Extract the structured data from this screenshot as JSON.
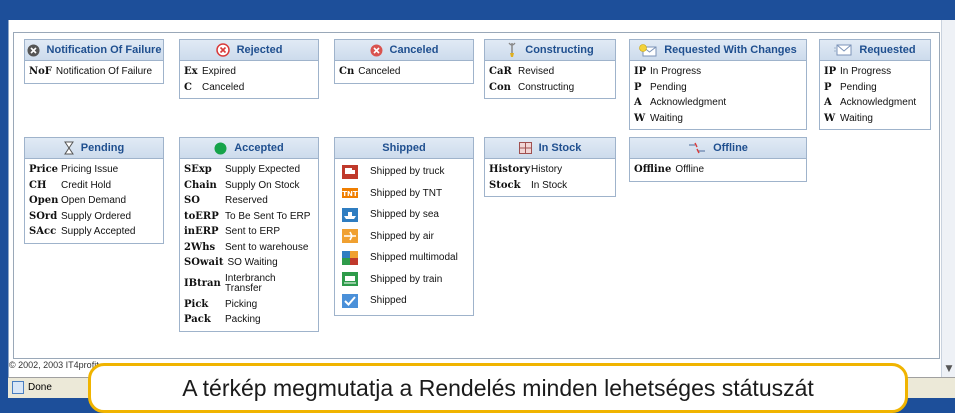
{
  "cards": {
    "nof": {
      "title": "Notification Of Failure",
      "rows": [
        {
          "code": "NoF",
          "label": "Notification Of Failure"
        }
      ]
    },
    "rejected": {
      "title": "Rejected",
      "rows": [
        {
          "code": "Ex",
          "label": "Expired"
        },
        {
          "code": "C",
          "label": "Canceled"
        }
      ]
    },
    "canceled": {
      "title": "Canceled",
      "rows": [
        {
          "code": "Cn",
          "label": "Canceled"
        }
      ]
    },
    "constructing": {
      "title": "Constructing",
      "rows": [
        {
          "code": "CaR",
          "label": "Revised"
        },
        {
          "code": "Con",
          "label": "Constructing"
        }
      ]
    },
    "req_changes": {
      "title": "Requested With Changes",
      "rows": [
        {
          "code": "IP",
          "label": "In Progress"
        },
        {
          "code": "P",
          "label": "Pending"
        },
        {
          "code": "A",
          "label": "Acknowledgment"
        },
        {
          "code": "W",
          "label": "Waiting"
        }
      ]
    },
    "requested": {
      "title": "Requested",
      "rows": [
        {
          "code": "IP",
          "label": "In Progress"
        },
        {
          "code": "P",
          "label": "Pending"
        },
        {
          "code": "A",
          "label": "Acknowledgment"
        },
        {
          "code": "W",
          "label": "Waiting"
        }
      ]
    },
    "pending": {
      "title": "Pending",
      "rows": [
        {
          "code": "Price",
          "label": "Pricing Issue"
        },
        {
          "code": "CH",
          "label": "Credit Hold"
        },
        {
          "code": "Open",
          "label": "Open Demand"
        },
        {
          "code": "SOrd",
          "label": "Supply Ordered"
        },
        {
          "code": "SAcc",
          "label": "Supply Accepted"
        }
      ]
    },
    "accepted": {
      "title": "Accepted",
      "rows": [
        {
          "code": "SExp",
          "label": "Supply Expected"
        },
        {
          "code": "Chain",
          "label": "Supply On Stock"
        },
        {
          "code": "SO",
          "label": "Reserved"
        },
        {
          "code": "toERP",
          "label": "To Be Sent To ERP"
        },
        {
          "code": "inERP",
          "label": "Sent to ERP"
        },
        {
          "code": "2Whs",
          "label": "Sent to warehouse"
        },
        {
          "code": "SOwait",
          "label": "SO Waiting"
        },
        {
          "code": "IBtran",
          "label": "Interbranch Transfer"
        },
        {
          "code": "Pick",
          "label": "Picking"
        },
        {
          "code": "Pack",
          "label": "Packing"
        }
      ]
    },
    "shipped": {
      "title": "Shipped",
      "rows": [
        {
          "icon": "truck-icon",
          "label": "Shipped by truck"
        },
        {
          "icon": "tnt-logo-icon",
          "label": "Shipped by TNT"
        },
        {
          "icon": "ship-icon",
          "label": "Shipped by sea"
        },
        {
          "icon": "airplane-icon",
          "label": "Shipped by air"
        },
        {
          "icon": "multimodal-icon",
          "label": "Shipped multimodal"
        },
        {
          "icon": "train-icon",
          "label": "Shipped by train"
        },
        {
          "icon": "checkmark-icon",
          "label": "Shipped"
        }
      ]
    },
    "instock": {
      "title": "In Stock",
      "rows": [
        {
          "code": "History",
          "label": "History"
        },
        {
          "code": "Stock",
          "label": "In Stock"
        }
      ]
    },
    "offline": {
      "title": "Offline",
      "rows": [
        {
          "code": "Offline",
          "label": "Offline"
        }
      ]
    }
  },
  "footer": {
    "copyright": "© 2002, 2003 IT4profit"
  },
  "status_bar": {
    "text": "Done"
  },
  "caption": {
    "text": "A térkép megmutatja a Rendelés minden lehetséges státuszát"
  },
  "colors": {
    "background": "#1d4f9a",
    "header_text": "#1f4f8f",
    "caption_border": "#f0b400",
    "accepted_dot": "#16a34a",
    "rejected_red": "#d93b3b"
  }
}
